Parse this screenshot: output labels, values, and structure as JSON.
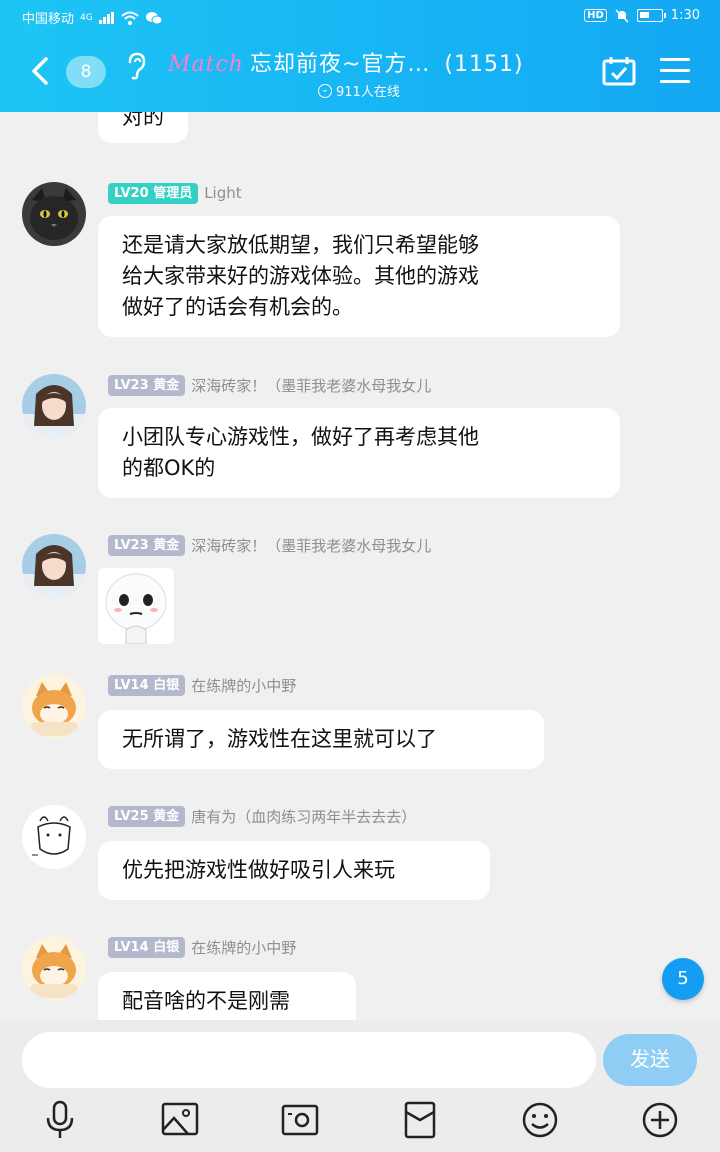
{
  "status_bar": {
    "carrier": "中国移动",
    "network": "4G",
    "hd": "HD",
    "time": "1:30"
  },
  "header": {
    "back_icon": "chevron-left-icon",
    "unread_count": "8",
    "brand": "Match",
    "group_name": "忘却前夜~官方…",
    "member_count": "(1151)",
    "online": "911人在线"
  },
  "messages": [
    {
      "type": "text",
      "text": "对的"
    },
    {
      "type": "text",
      "level": "LV20",
      "title": "管理员",
      "nick": "Light",
      "lines": [
        "还是请大家放低期望，我们只希望能够",
        "给大家带来好的游戏体验。其他的游戏",
        "做好了的话会有机会的。"
      ]
    },
    {
      "type": "text",
      "level": "LV23",
      "title": "黄金",
      "nick": "深海砖家！（墨菲我老婆水母我女儿",
      "lines": [
        "小团队专心游戏性，做好了再考虑其他",
        "的都OK的"
      ]
    },
    {
      "type": "sticker",
      "level": "LV23",
      "title": "黄金",
      "nick": "深海砖家！（墨菲我老婆水母我女儿"
    },
    {
      "type": "text",
      "level": "LV14",
      "title": "白银",
      "nick": "在练牌的小中野",
      "lines": [
        "无所谓了，游戏性在这里就可以了"
      ]
    },
    {
      "type": "text",
      "level": "LV25",
      "title": "黄金",
      "nick": "唐有为（血肉练习两年半去去去）",
      "lines": [
        "优先把游戏性做好吸引人来玩"
      ]
    },
    {
      "type": "text",
      "level": "LV14",
      "title": "白银",
      "nick": "在练牌的小中野",
      "lines": [
        "配音啥的不是刚需"
      ]
    }
  ],
  "new_message_badge": "5",
  "composer": {
    "placeholder": "",
    "send_label": "发送"
  },
  "colors": {
    "header_gradient_start": "#1ec5f4",
    "header_gradient_end": "#14a8f3",
    "admin_badge": "#32d1c4",
    "level_badge": "#b3b8cc",
    "send_button": "#8fcdf5",
    "unread_badge": "#149df5"
  }
}
